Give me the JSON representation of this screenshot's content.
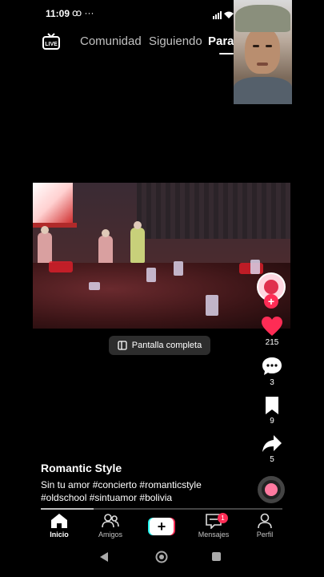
{
  "status_bar": {
    "time": "11:09",
    "left_icons": "ꝏ ···"
  },
  "top_nav": {
    "live_label": "LIVE",
    "tabs": [
      {
        "label": "Comunidad",
        "active": false
      },
      {
        "label": "Siguiendo",
        "active": false
      },
      {
        "label": "Para",
        "active": true
      }
    ]
  },
  "video": {
    "fullscreen_label": "Pantalla completa"
  },
  "actions": {
    "likes": "215",
    "comments": "3",
    "saves": "9",
    "shares": "5",
    "follow_symbol": "+"
  },
  "caption": {
    "username": "Romantic Style",
    "line1": "Sin tu amor #concierto #romanticstyle",
    "line2": "#oldschool #sintuamor #bolivia"
  },
  "progress": {
    "fraction": 0.22
  },
  "bottom_nav": {
    "home": "Inicio",
    "friends": "Amigos",
    "create": "+",
    "inbox": "Mensajes",
    "inbox_badge": "1",
    "profile": "Perfil"
  },
  "colors": {
    "accent": "#fe2c55",
    "cyan": "#25f4ee",
    "background": "#000000"
  }
}
